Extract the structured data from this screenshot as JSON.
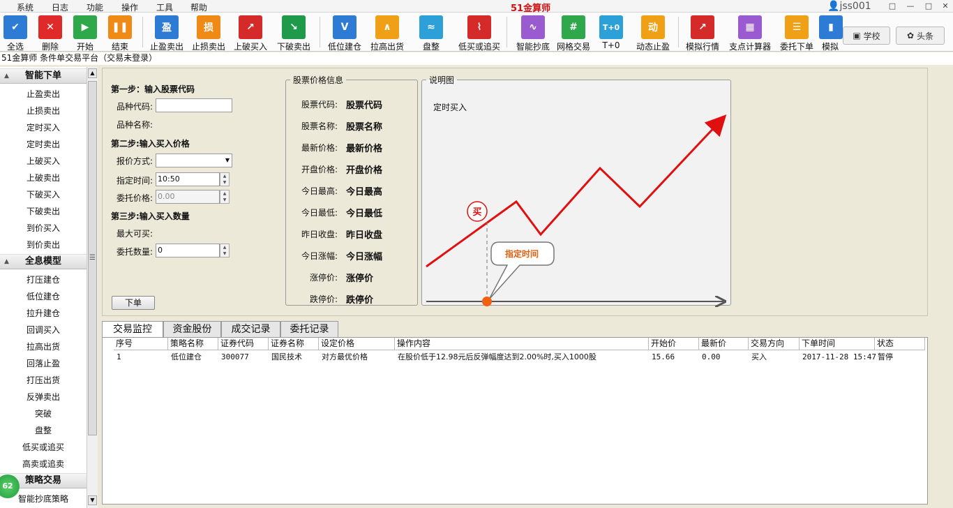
{
  "menu": [
    "系统",
    "日志",
    "功能",
    "操作",
    "工具",
    "帮助"
  ],
  "brand": "51金算师",
  "user": "jss001",
  "window_buttons": [
    "□",
    "—",
    "□",
    "✕"
  ],
  "toolbar": [
    {
      "label": "全选",
      "color": "#2e7bd6",
      "glyph": "✔",
      "name": "select-all"
    },
    {
      "label": "删除",
      "color": "#e02a2a",
      "glyph": "✕",
      "name": "delete"
    },
    {
      "label": "开始",
      "color": "#2ea84a",
      "glyph": "▶",
      "name": "start"
    },
    {
      "label": "结束",
      "color": "#f08a16",
      "glyph": "❚❚",
      "name": "stop"
    },
    {
      "label": "止盈卖出",
      "color": "#2e7bd6",
      "glyph": "盈",
      "name": "take-profit-sell"
    },
    {
      "label": "止损卖出",
      "color": "#f08a16",
      "glyph": "损",
      "name": "stop-loss-sell"
    },
    {
      "label": "上破买入",
      "color": "#d52a2a",
      "glyph": "↗",
      "name": "break-up-buy"
    },
    {
      "label": "下破卖出",
      "color": "#1f9a4a",
      "glyph": "↘",
      "name": "break-down-sell"
    },
    {
      "label": "低位建仓",
      "color": "#2e7bd6",
      "glyph": "V",
      "name": "low-build"
    },
    {
      "label": "拉高出货",
      "color": "#f0a016",
      "glyph": "∧",
      "name": "pull-high-sell"
    },
    {
      "label": "盘整",
      "color": "#2ea0d8",
      "glyph": "≈",
      "name": "consolidation"
    },
    {
      "label": "低买或追买",
      "color": "#d52a2a",
      "glyph": "⌇",
      "name": "low-buy-chase"
    },
    {
      "label": "智能抄底",
      "color": "#9a5ad0",
      "glyph": "∿",
      "name": "smart-bottom"
    },
    {
      "label": "网格交易",
      "color": "#2ea84a",
      "glyph": "#",
      "name": "grid-trade"
    },
    {
      "label": "T+0",
      "color": "#2ea0d8",
      "glyph": "T+0",
      "name": "t-plus-zero"
    },
    {
      "label": "动态止盈",
      "color": "#f0a016",
      "glyph": "动",
      "name": "dynamic-take-profit"
    },
    {
      "label": "模拟行情",
      "color": "#d52a2a",
      "glyph": "↗",
      "name": "sim-market"
    },
    {
      "label": "支点计算器",
      "color": "#9a5ad0",
      "glyph": "▦",
      "name": "pivot-calc"
    },
    {
      "label": "委托下单",
      "color": "#f0a016",
      "glyph": "☰",
      "name": "entrust-order"
    },
    {
      "label": "模拟",
      "color": "#2e7bd6",
      "glyph": "▮",
      "name": "sim"
    }
  ],
  "side_buttons": {
    "school": "学校",
    "headlines": "头条"
  },
  "title": "51金算师 条件单交易平台（交易未登录）",
  "sidebar": {
    "groups": [
      {
        "title": "智能下单",
        "items": [
          "止盈卖出",
          "止损卖出",
          "定时买入",
          "定时卖出",
          "上破买入",
          "上破卖出",
          "下破买入",
          "下破卖出",
          "到价买入",
          "到价卖出"
        ]
      },
      {
        "title": "全息模型",
        "items": [
          "打压建仓",
          "低位建仓",
          "拉升建仓",
          "回调买入",
          "拉高出货",
          "回落止盈",
          "打压出货",
          "反弹卖出",
          "突破",
          "盘整",
          "低买或追买",
          "高卖或追卖"
        ]
      },
      {
        "title": "策略交易",
        "items": [
          "智能抄底策略"
        ]
      }
    ],
    "badge": "62"
  },
  "form": {
    "step1": "第一步：输入股票代码",
    "code_label": "品种代码:",
    "code_value": "",
    "name_label": "品种名称:",
    "step2": "第二步:输入买入价格",
    "price_mode_label": "报价方式:",
    "price_mode_value": "",
    "time_label": "指定时间:",
    "time_value": "10:50",
    "entrust_price_label": "委托价格:",
    "entrust_price_value": "0.00",
    "step3": "第三步:输入买入数量",
    "max_buy_label": "最大可买:",
    "qty_label": "委托数量:",
    "qty_value": "0",
    "order_button": "下单"
  },
  "price_info": {
    "legend": "股票价格信息",
    "rows": [
      {
        "k": "股票代码:",
        "v": "股票代码"
      },
      {
        "k": "股票名称:",
        "v": "股票名称"
      },
      {
        "k": "最新价格:",
        "v": "最新价格"
      },
      {
        "k": "开盘价格:",
        "v": "开盘价格"
      },
      {
        "k": "今日最高:",
        "v": "今日最高"
      },
      {
        "k": "今日最低:",
        "v": "今日最低"
      },
      {
        "k": "昨日收盘:",
        "v": "昨日收盘"
      },
      {
        "k": "今日涨幅:",
        "v": "今日涨幅"
      },
      {
        "k": "涨停价:",
        "v": "涨停价"
      },
      {
        "k": "跌停价:",
        "v": "跌停价"
      }
    ]
  },
  "diagram": {
    "legend": "说明图",
    "caption": "定时买入",
    "buy_marker": "买",
    "callout": "指定时间",
    "line_color": "#e01010",
    "dot_color": "#f06010"
  },
  "tabs": [
    "交易监控",
    "资金股份",
    "成交记录",
    "委托记录"
  ],
  "grid": {
    "headers": [
      "序号",
      "策略名称",
      "证券代码",
      "证券名称",
      "设定价格",
      "操作内容",
      "开始价",
      "最新价",
      "交易方向",
      "下单时间",
      "状态"
    ],
    "rows": [
      [
        "1",
        "低位建仓",
        "300077",
        "国民技术",
        "对方最优价格",
        "在股价低于12.98元后反弹幅度达到2.00%时,买入1000股",
        "15.66",
        "0.00",
        "买入",
        "2017-11-28 15:47",
        "暂停"
      ]
    ]
  }
}
